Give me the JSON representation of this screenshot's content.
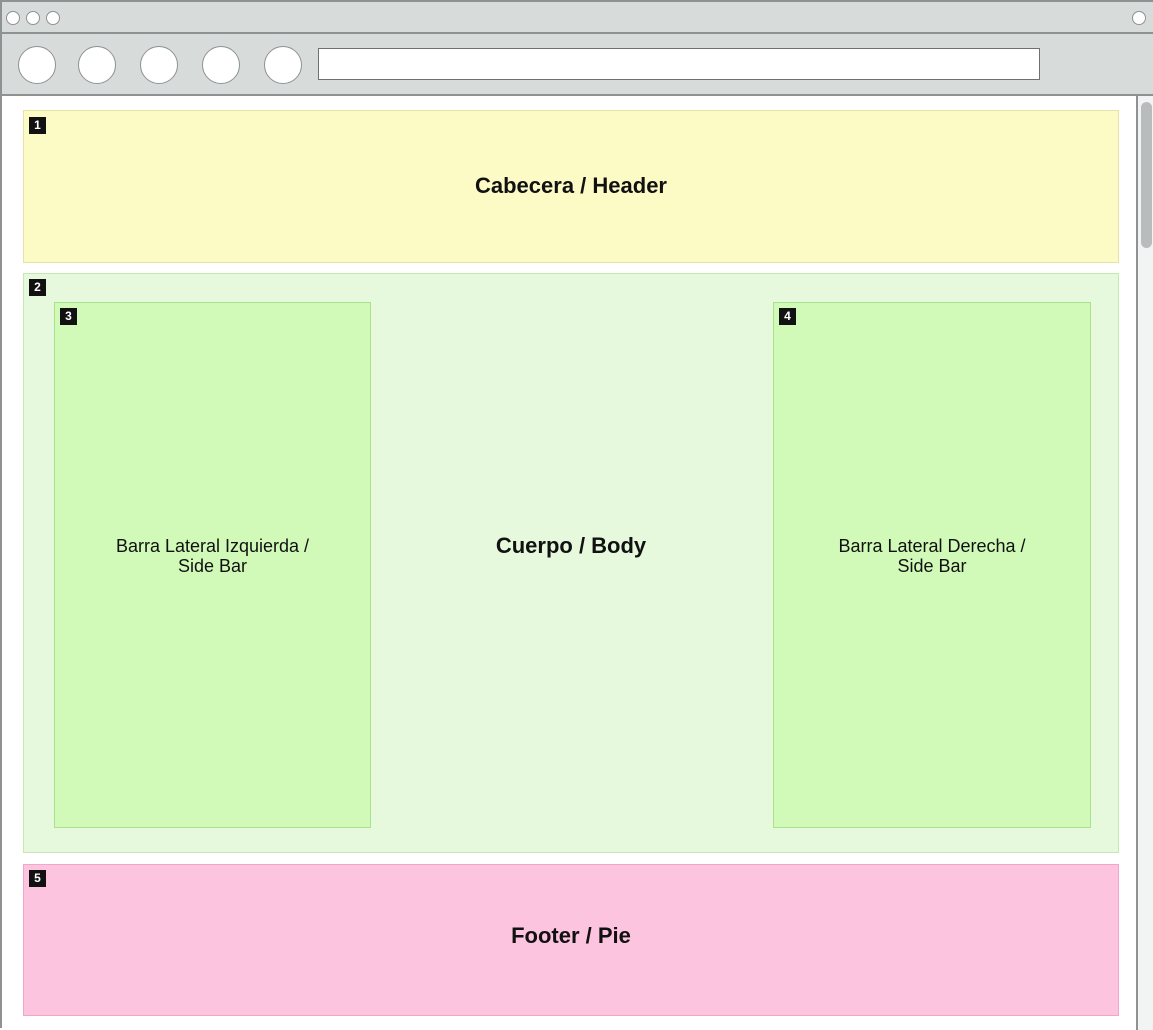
{
  "diagram": {
    "header": {
      "badge": "1",
      "label": "Cabecera / Header"
    },
    "body": {
      "badge": "2",
      "label": "Cuerpo / Body"
    },
    "left_sidebar": {
      "badge": "3",
      "label": "Barra Lateral Izquierda /\nSide Bar"
    },
    "right_sidebar": {
      "badge": "4",
      "label": "Barra Lateral Derecha /\nSide Bar"
    },
    "footer": {
      "badge": "5",
      "label": "Footer / Pie"
    }
  },
  "browser": {
    "address_bar_value": ""
  },
  "colors": {
    "header_fill": "#fcfac5",
    "body_fill": "#e7f9dc",
    "sidebar_fill": "#d1f9b8",
    "footer_fill": "#fdc4df",
    "chrome_gray": "#d7dbd9"
  }
}
